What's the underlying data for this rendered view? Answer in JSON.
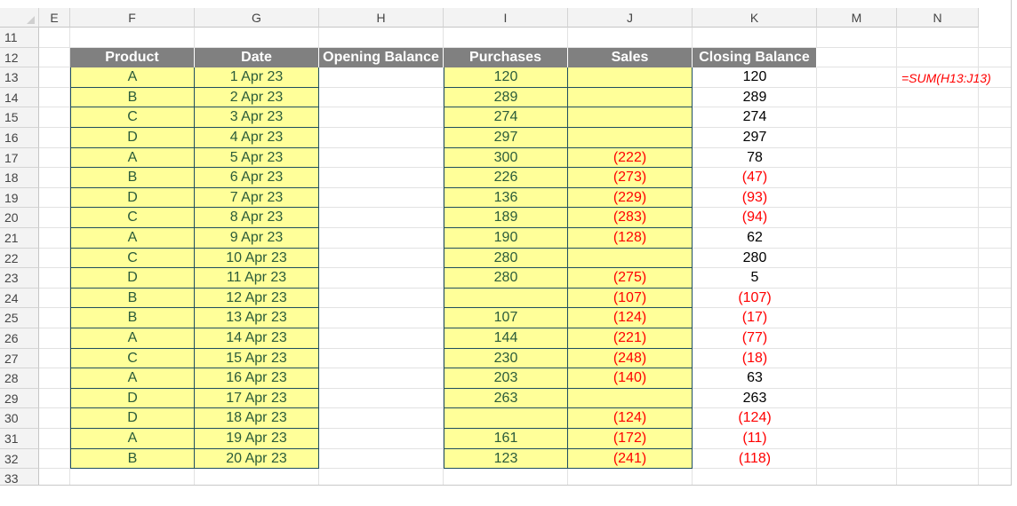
{
  "columns": [
    "E",
    "F",
    "G",
    "H",
    "I",
    "J",
    "K",
    "M",
    "N"
  ],
  "rows": [
    "11",
    "12",
    "13",
    "14",
    "15",
    "16",
    "17",
    "18",
    "19",
    "20",
    "21",
    "22",
    "23",
    "24",
    "25",
    "26",
    "27",
    "28",
    "29",
    "30",
    "31",
    "32",
    "33"
  ],
  "table": {
    "headers": [
      "Product",
      "Date",
      "Opening Balance",
      "Purchases",
      "Sales",
      "Closing Balance"
    ],
    "data": [
      {
        "product": "A",
        "date": "1 Apr 23",
        "purchases": "120",
        "sales": "",
        "closing": "120"
      },
      {
        "product": "B",
        "date": "2 Apr 23",
        "purchases": "289",
        "sales": "",
        "closing": "289"
      },
      {
        "product": "C",
        "date": "3 Apr 23",
        "purchases": "274",
        "sales": "",
        "closing": "274"
      },
      {
        "product": "D",
        "date": "4 Apr 23",
        "purchases": "297",
        "sales": "",
        "closing": "297"
      },
      {
        "product": "A",
        "date": "5 Apr 23",
        "purchases": "300",
        "sales": "(222)",
        "closing": "78"
      },
      {
        "product": "B",
        "date": "6 Apr 23",
        "purchases": "226",
        "sales": "(273)",
        "closing": "(47)"
      },
      {
        "product": "D",
        "date": "7 Apr 23",
        "purchases": "136",
        "sales": "(229)",
        "closing": "(93)"
      },
      {
        "product": "C",
        "date": "8 Apr 23",
        "purchases": "189",
        "sales": "(283)",
        "closing": "(94)"
      },
      {
        "product": "A",
        "date": "9 Apr 23",
        "purchases": "190",
        "sales": "(128)",
        "closing": "62"
      },
      {
        "product": "C",
        "date": "10 Apr 23",
        "purchases": "280",
        "sales": "",
        "closing": "280"
      },
      {
        "product": "D",
        "date": "11 Apr 23",
        "purchases": "280",
        "sales": "(275)",
        "closing": "5"
      },
      {
        "product": "B",
        "date": "12 Apr 23",
        "purchases": "",
        "sales": "(107)",
        "closing": "(107)"
      },
      {
        "product": "B",
        "date": "13 Apr 23",
        "purchases": "107",
        "sales": "(124)",
        "closing": "(17)"
      },
      {
        "product": "A",
        "date": "14 Apr 23",
        "purchases": "144",
        "sales": "(221)",
        "closing": "(77)"
      },
      {
        "product": "C",
        "date": "15 Apr 23",
        "purchases": "230",
        "sales": "(248)",
        "closing": "(18)"
      },
      {
        "product": "A",
        "date": "16 Apr 23",
        "purchases": "203",
        "sales": "(140)",
        "closing": "63"
      },
      {
        "product": "D",
        "date": "17 Apr 23",
        "purchases": "263",
        "sales": "",
        "closing": "263"
      },
      {
        "product": "D",
        "date": "18 Apr 23",
        "purchases": "",
        "sales": "(124)",
        "closing": "(124)"
      },
      {
        "product": "A",
        "date": "19 Apr 23",
        "purchases": "161",
        "sales": "(172)",
        "closing": "(11)"
      },
      {
        "product": "B",
        "date": "20 Apr 23",
        "purchases": "123",
        "sales": "(241)",
        "closing": "(118)"
      }
    ]
  },
  "formula_note": "=SUM(H13:J13)",
  "colors": {
    "header_bg": "#808080",
    "input_bg": "#ffff99",
    "negative": "#ff0000",
    "input_text": "#2a5b3a"
  }
}
